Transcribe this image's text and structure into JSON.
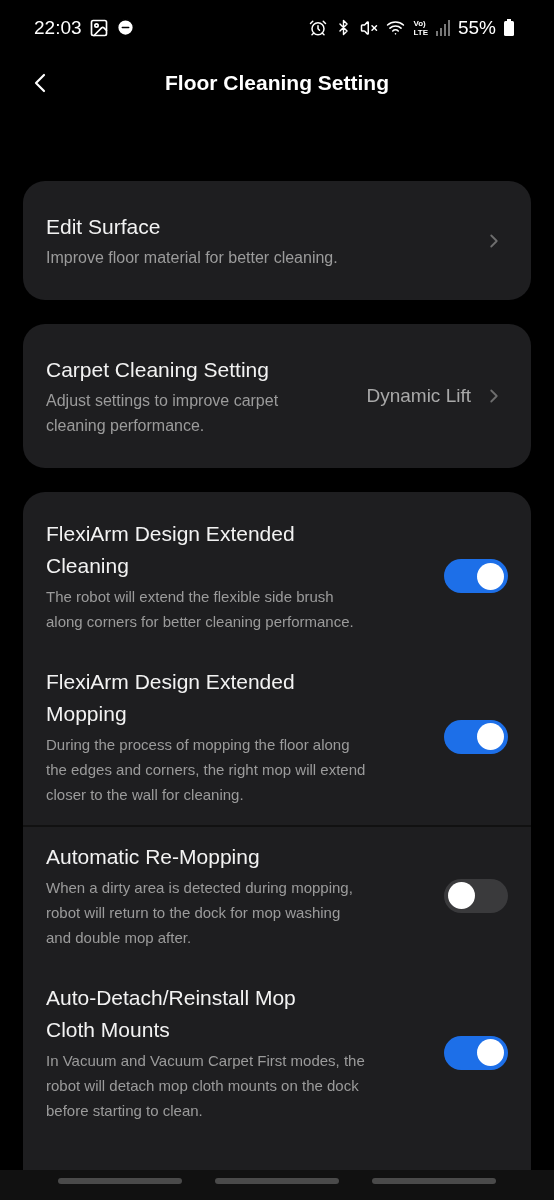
{
  "status_bar": {
    "time": "22:03",
    "volte_top": "Vo)",
    "volte_bottom": "LTE",
    "battery": "55%"
  },
  "header": {
    "title": "Floor Cleaning Setting"
  },
  "link_cards": [
    {
      "title": "Edit Surface",
      "description": "Improve floor material for better cleaning."
    },
    {
      "title": "Carpet Cleaning Setting",
      "description": "Adjust settings to improve carpet cleaning performance.",
      "value": "Dynamic Lift"
    }
  ],
  "toggle_settings": [
    {
      "title": "FlexiArm Design Extended Cleaning",
      "description": "The robot will extend the flexible side brush along corners for better cleaning performance.",
      "on": true,
      "divider_above": false
    },
    {
      "title": "FlexiArm Design Extended Mopping",
      "description": "During the process of mopping the floor along the edges and corners, the right mop will extend closer to the wall for cleaning.",
      "on": true,
      "divider_above": false
    },
    {
      "title": "Automatic Re-Mopping",
      "description": "When a dirty area is detected during mopping, robot will return to the dock for mop washing and double mop after.",
      "on": false,
      "divider_above": true
    },
    {
      "title": "Auto-Detach/Reinstall Mop Cloth Mounts",
      "description": "In Vacuum and Vacuum Carpet First modes, the robot will detach mop cloth mounts on the dock before starting to clean.",
      "on": true,
      "divider_above": false
    }
  ]
}
